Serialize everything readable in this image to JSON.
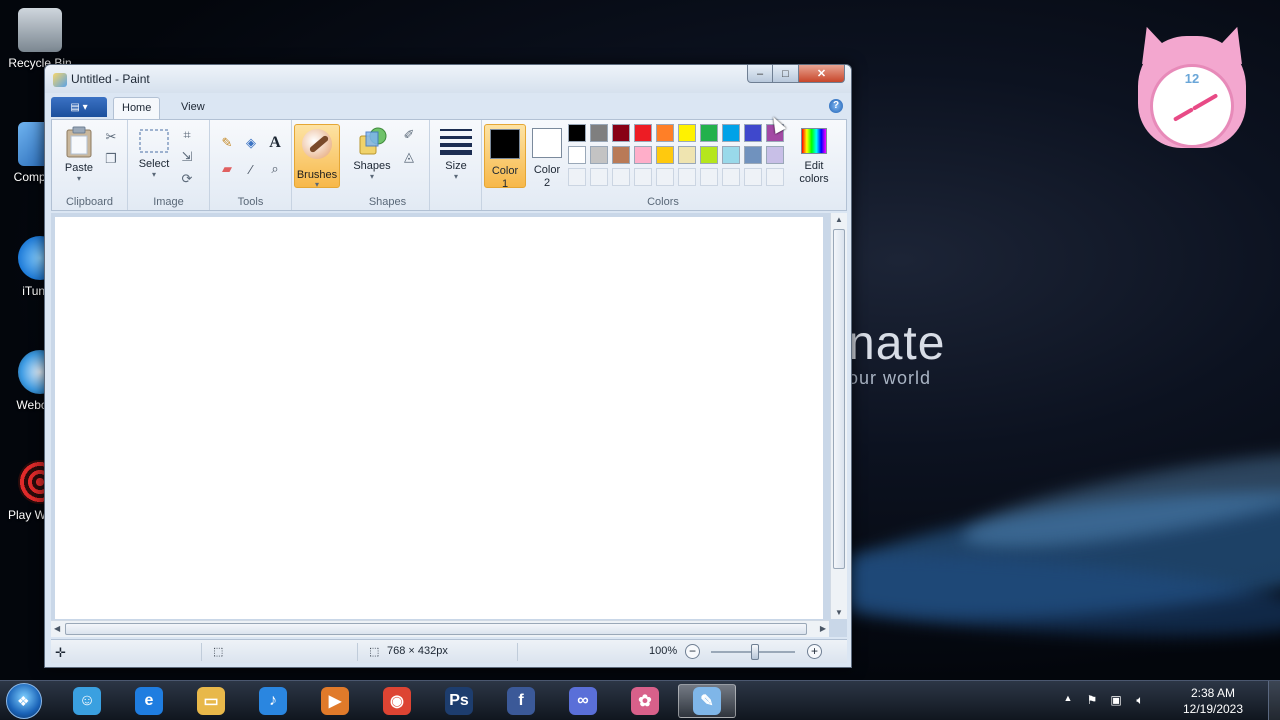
{
  "desktop": {
    "icons": [
      {
        "label": "Recycle Bin",
        "icon": "recycle-bin-icon"
      },
      {
        "label": "Computer",
        "icon": "computer-icon"
      },
      {
        "label": "iTunes",
        "icon": "itunes-icon"
      },
      {
        "label": "Webcam",
        "icon": "webcam-icon"
      },
      {
        "label": "Play Wizard",
        "icon": "play-wizard-icon"
      }
    ],
    "wallpaper_word": "nate",
    "wallpaper_tagline": "our world",
    "gadget_clock_number": "12"
  },
  "window": {
    "title": "Untitled - Paint",
    "caption": {
      "minimize": "–",
      "maximize": "□",
      "close": "✕"
    },
    "tabs": [
      {
        "label": "Home",
        "active": true
      },
      {
        "label": "View",
        "active": false
      }
    ],
    "help": "?"
  },
  "ribbon": {
    "groups": {
      "clipboard": "Clipboard",
      "image": "Image",
      "tools": "Tools",
      "shapes": "Shapes",
      "colors": "Colors"
    },
    "paste": "Paste",
    "select": "Select",
    "brushes": "Brushes",
    "shapes_btn": "Shapes",
    "size": "Size",
    "color1": {
      "line1": "Color",
      "line2": "1",
      "value": "#000000"
    },
    "color2": {
      "line1": "Color",
      "line2": "2",
      "value": "#ffffff"
    },
    "edit_colors": {
      "line1": "Edit",
      "line2": "colors"
    },
    "text_tool": "A",
    "palette_row1": [
      "#000000",
      "#7f7f7f",
      "#880015",
      "#ed1c24",
      "#ff7f27",
      "#fff200",
      "#22b14c",
      "#00a2e8",
      "#3f48cc",
      "#a349a4"
    ],
    "palette_row2": [
      "#ffffff",
      "#c3c3c3",
      "#b97a57",
      "#ffaec9",
      "#ffc90e",
      "#efe4b0",
      "#b5e61d",
      "#99d9ea",
      "#7092be",
      "#c8bfe7"
    ]
  },
  "statusbar": {
    "image_size": "768 × 432px",
    "zoom_level": "100%",
    "zoom_out": "−",
    "zoom_in": "+"
  },
  "taskbar": {
    "apps": [
      {
        "name": "messenger-icon",
        "color": "#3aa0e0",
        "glyph": "☺"
      },
      {
        "name": "internet-explorer-icon",
        "color": "#1f7de0",
        "glyph": "e"
      },
      {
        "name": "file-explorer-icon",
        "color": "#e8b84a",
        "glyph": "▭"
      },
      {
        "name": "itunes-icon",
        "color": "#2a86e0",
        "glyph": "♪"
      },
      {
        "name": "media-player-icon",
        "color": "#e07a2a",
        "glyph": "▶"
      },
      {
        "name": "chrome-icon",
        "color": "#dd4433",
        "glyph": "◉"
      },
      {
        "name": "photoshop-icon",
        "color": "#1d3d6e",
        "glyph": "Ps"
      },
      {
        "name": "facebook-icon",
        "color": "#3b5998",
        "glyph": "f"
      },
      {
        "name": "infinity-app-icon",
        "color": "#5a6fd8",
        "glyph": "∞"
      },
      {
        "name": "paint-balloon-icon",
        "color": "#d8608a",
        "glyph": "✿"
      },
      {
        "name": "paint-app-icon",
        "color": "#7fb6e8",
        "glyph": "✎",
        "active": true
      }
    ],
    "tray": {
      "show_hidden": "▲",
      "time": "2:38 AM",
      "date": "12/19/2023"
    }
  }
}
